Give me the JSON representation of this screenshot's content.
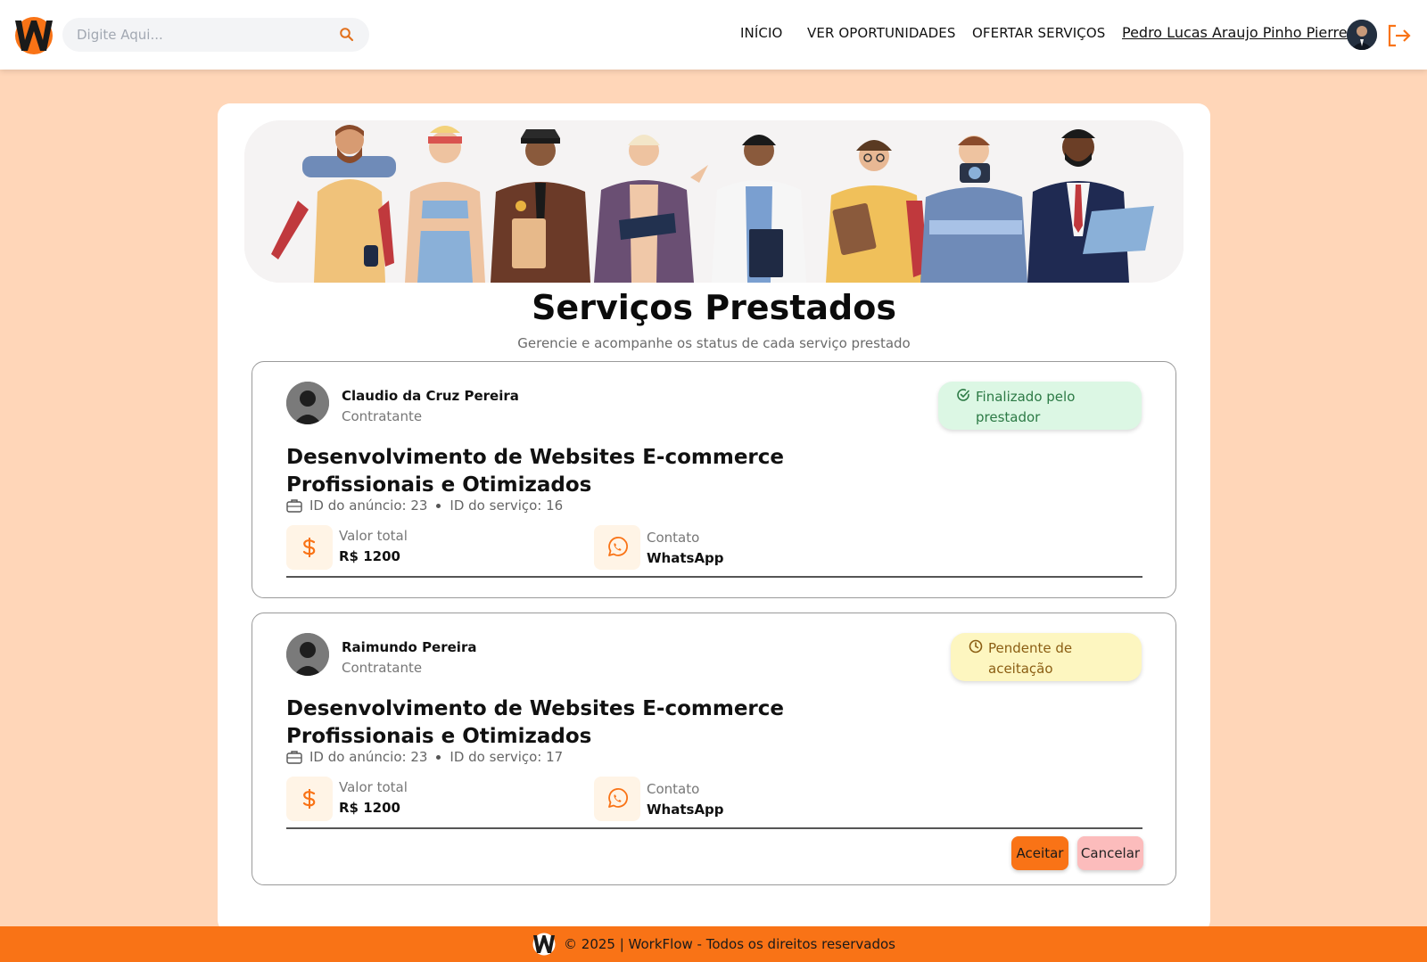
{
  "header": {
    "search_placeholder": "Digite Aqui...",
    "nav": [
      "INÍCIO",
      "VER OPORTUNIDADES",
      "OFERTAR SERVIÇOS"
    ],
    "user_name": "Pedro Lucas Araujo Pinho Pierre"
  },
  "page": {
    "title": "Serviços Prestados",
    "subtitle": "Gerencie e acompanhe os status de cada serviço prestado"
  },
  "services": [
    {
      "client_name": "Claudio da Cruz Pereira",
      "client_role": "Contratante",
      "status": "Finalizado pelo prestador",
      "status_icon": "check-circle-icon",
      "title": "Desenvolvimento de Websites E-commerce Profissionais e Otimizados",
      "ad_id": "ID do anúncio: 23",
      "service_id": "ID do serviço: 16",
      "value_label": "Valor total",
      "value": "R$ 1200",
      "contact_label": "Contato",
      "contact": "WhatsApp"
    },
    {
      "client_name": "Raimundo Pereira",
      "client_role": "Contratante",
      "status": "Pendente de aceitação",
      "status_icon": "clock-icon",
      "title": "Desenvolvimento de Websites E-commerce Profissionais e Otimizados",
      "ad_id": "ID do anúncio: 23",
      "service_id": "ID do serviço: 17",
      "value_label": "Valor total",
      "value": "R$ 1200",
      "contact_label": "Contato",
      "contact": "WhatsApp",
      "accept_label": "Aceitar",
      "cancel_label": "Cancelar"
    }
  ],
  "footer": {
    "text": "© 2025 | WorkFlow - Todos os direitos reservados"
  },
  "colors": {
    "accent": "#f97316",
    "background": "#ffd6b8",
    "status_done_bg": "#dcf7e4",
    "status_pending_bg": "#fdf6c0"
  }
}
